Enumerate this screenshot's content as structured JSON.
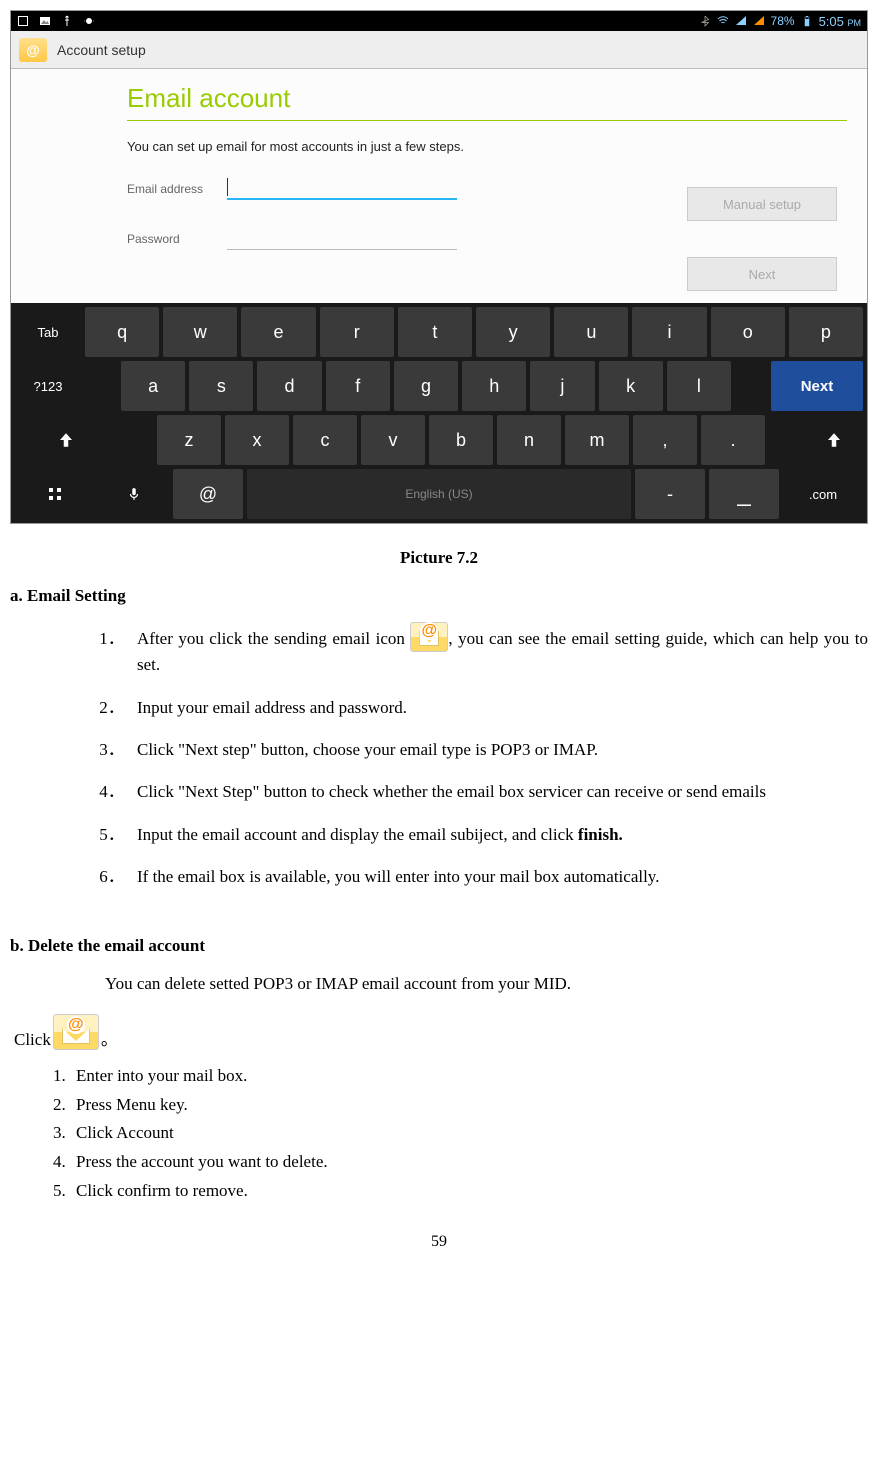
{
  "statusbar": {
    "battery_text": "78%",
    "time": "5:05",
    "ampm": "PM"
  },
  "appbar": {
    "title": "Account setup"
  },
  "email_setup": {
    "title": "Email account",
    "intro": "You can set up email for most accounts in just a few steps.",
    "email_label": "Email address",
    "password_label": "Password",
    "manual_btn": "Manual setup",
    "next_btn": "Next"
  },
  "keyboard": {
    "row1": [
      "Tab",
      "q",
      "w",
      "e",
      "r",
      "t",
      "y",
      "u",
      "i",
      "o",
      "p"
    ],
    "row2": [
      "?123",
      "a",
      "s",
      "d",
      "f",
      "g",
      "h",
      "j",
      "k",
      "l",
      "Next"
    ],
    "row3_mid": [
      "z",
      "x",
      "c",
      "v",
      "b",
      "n",
      "m",
      ",",
      "."
    ],
    "row4": {
      "at": "@",
      "space": "English (US)",
      "dash": "-",
      "under": "_",
      "dotcom": ".com"
    }
  },
  "doc": {
    "caption": "Picture 7.2",
    "section_a_title": "a. Email Setting",
    "a_steps": [
      {
        "pre": "After you click the sending email icon ",
        "post": ", you can see the email setting guide, which can help you to set."
      },
      "Input your email address and password.",
      "Click \"Next step\" button, choose your email type is POP3 or IMAP.",
      "Click \"Next Step\" button to check whether the email box servicer can receive or send emails",
      {
        "pre": "Input the email account and display the email subiject, and click ",
        "bold": "finish."
      },
      "If the email box is available, you will enter into your mail box automatically."
    ],
    "section_b_title": "b. Delete the email account",
    "b_intro": "You can delete setted POP3 or IMAP email account from your MID.",
    "click_label": "Click",
    "click_suffix": "。",
    "b_steps": [
      "Enter into your mail box.",
      "Press Menu key.",
      "Click Account",
      "Press the account you want to delete.",
      "Click confirm to remove."
    ],
    "page_number": "59"
  }
}
